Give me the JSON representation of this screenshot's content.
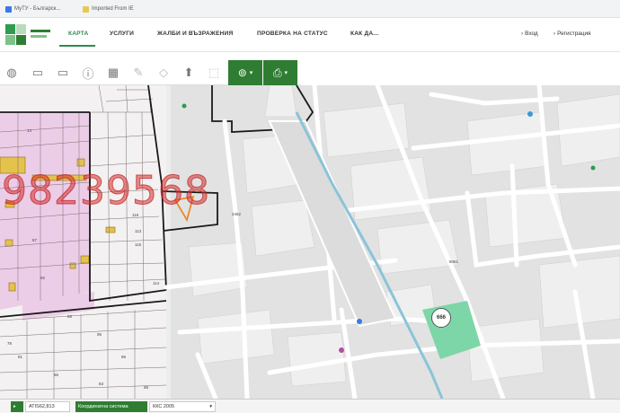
{
  "browser": {
    "bookmarks": [
      {
        "label": "МуТУ - Българск...",
        "color": "#3b78e7"
      },
      {
        "label": "Imported From IE",
        "color": "#e8c94b"
      }
    ]
  },
  "nav": {
    "items": [
      {
        "label": "КАРТА",
        "active": true
      },
      {
        "label": "УСЛУГИ",
        "active": false
      },
      {
        "label": "ЖАЛБИ И ВЪЗРАЖЕНИЯ",
        "active": false
      },
      {
        "label": "ПРОВЕРКА НА СТАТУС",
        "active": false
      },
      {
        "label": "КАК ДА...",
        "active": false
      }
    ],
    "login": "Вход",
    "register": "Регистрация"
  },
  "toolbar": {
    "icons": [
      "globe-icon",
      "polygon-select-icon",
      "rectangle-icon",
      "info-icon",
      "layers-icon",
      "pencil-icon",
      "eraser-icon",
      "export-icon",
      "zoom-select-icon",
      "search-place-icon",
      "print-icon"
    ]
  },
  "map": {
    "watermark": "98239568",
    "badge": "666",
    "labels": {
      "l1": "113",
      "l2": "114",
      "l3": "116",
      "l4": "115",
      "l5": "87",
      "l6": "2462",
      "l7": "8061",
      "l8": "95",
      "l9": "81",
      "l10": "96",
      "l11": "66",
      "l12": "88",
      "l13": "92",
      "l14": "78",
      "l15": "83",
      "l16": "98",
      "l17": "14"
    }
  },
  "bottom": {
    "field1": "ATIS62,813",
    "field2": "Координатна система",
    "field3": "ККС 2005"
  },
  "colors": {
    "accent": "#2e7d32",
    "parcel_pink": "#eccde8",
    "building_yellow": "#e4c24e",
    "green_area": "#7dd6a7",
    "highlight": "#e88a2c"
  }
}
